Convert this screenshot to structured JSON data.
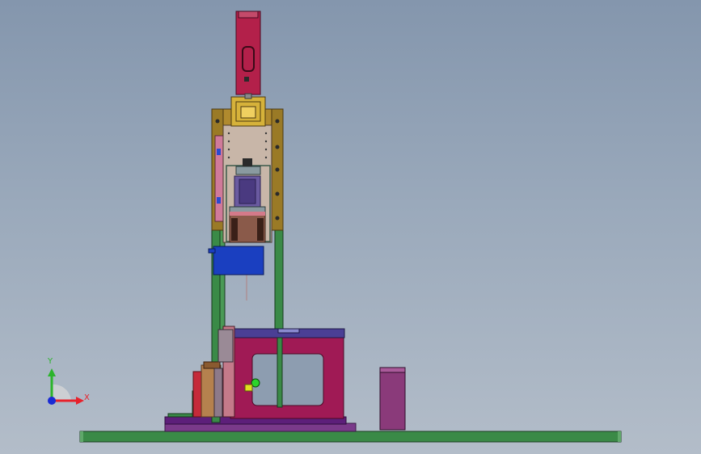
{
  "triad": {
    "x_label": "X",
    "y_label": "Y",
    "x_color": "#e8212b",
    "y_color": "#2bb42b",
    "z_color": "#1a2bd4"
  },
  "colors": {
    "frame_green": "#3a8a47",
    "plate_gold": "#b08a2e",
    "cylinder_red": "#b3204a",
    "base_purple": "#6e2a8a",
    "block_magenta": "#a01a55",
    "motor_blue": "#1a3fc0"
  }
}
